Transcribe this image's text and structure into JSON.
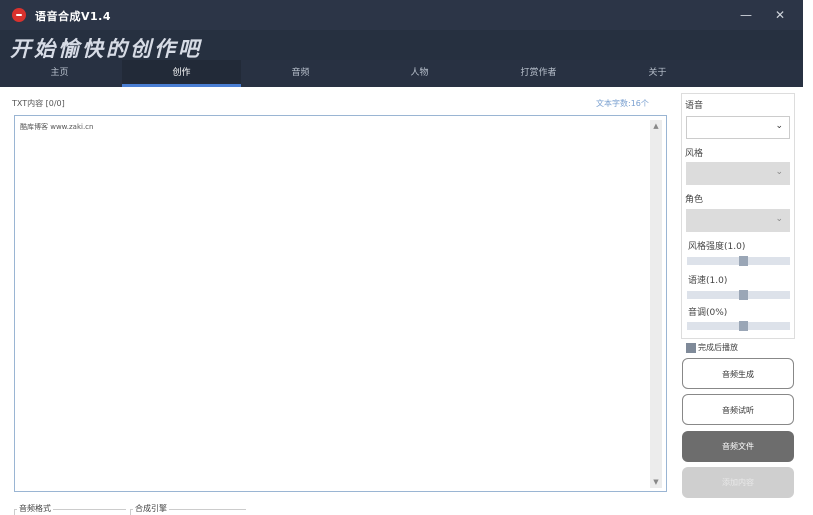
{
  "window": {
    "title": "语音合成V1.4",
    "minimize_glyph": "—",
    "close_glyph": "✕"
  },
  "banner": {
    "slogan": "开始愉快的创作吧"
  },
  "nav": {
    "tabs": [
      "主页",
      "创作",
      "音频",
      "人物",
      "打赏作者",
      "关于"
    ],
    "active": "创作"
  },
  "editor": {
    "label": "TXT内容 [0/0]",
    "char_count": "文本字数:16个",
    "content": "酷库博客 www.zaki.cn"
  },
  "settings": {
    "voice_label": "语音",
    "voice_value": "",
    "style_label": "风格",
    "style_value": "",
    "role_label": "角色",
    "role_value": "",
    "style_strength_label": "风格强度(1.0)",
    "style_strength_level": 0.55,
    "speed_label": "语速(1.0)",
    "speed_level": 0.55,
    "pitch_label": "音调(0%)",
    "pitch_level": 0.55
  },
  "auto_play": {
    "label": "完成后播放",
    "checked": true
  },
  "buttons": {
    "generate": "音频生成",
    "preview": "音频试听",
    "audio_file": "音频文件",
    "add_content": "添加内容"
  },
  "bottom": {
    "audio_format_label": "音频格式",
    "engine_label": "合成引擎"
  },
  "colors": {
    "titlebar": "#2c3547",
    "nav_active_underline": "#4a7ed3",
    "logo": "#d9322e"
  }
}
